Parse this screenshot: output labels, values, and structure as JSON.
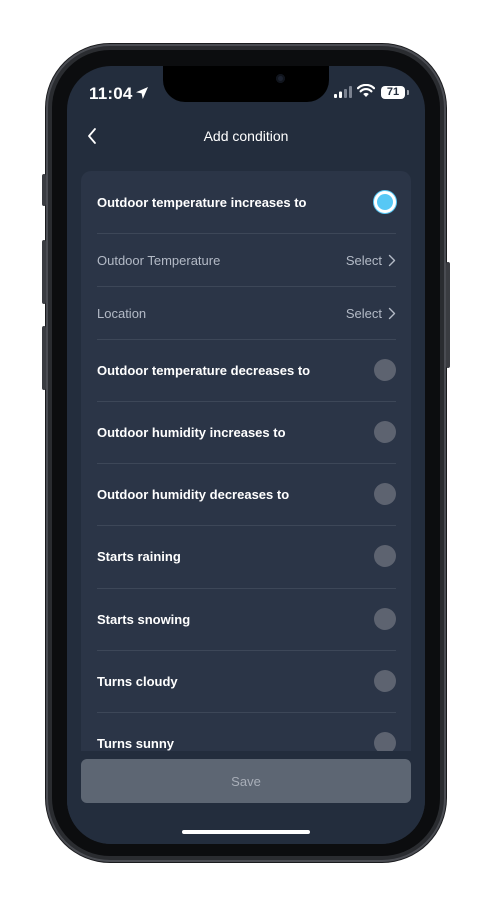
{
  "status_bar": {
    "time": "11:04",
    "battery": "71"
  },
  "header": {
    "title": "Add condition"
  },
  "conditions": [
    {
      "label": "Outdoor temperature increases to",
      "selected": true
    },
    {
      "label": "Outdoor temperature decreases to",
      "selected": false
    },
    {
      "label": "Outdoor humidity increases to",
      "selected": false
    },
    {
      "label": "Outdoor humidity decreases to",
      "selected": false
    },
    {
      "label": "Starts raining",
      "selected": false
    },
    {
      "label": "Starts snowing",
      "selected": false
    },
    {
      "label": "Turns cloudy",
      "selected": false
    },
    {
      "label": "Turns sunny",
      "selected": false
    }
  ],
  "sub_options": [
    {
      "label": "Outdoor Temperature",
      "action": "Select"
    },
    {
      "label": "Location",
      "action": "Select"
    }
  ],
  "footer": {
    "save_label": "Save"
  },
  "colors": {
    "background": "#232d3d",
    "card": "#2b3547",
    "accent": "#57c8f5",
    "radio_off": "#5d6370",
    "save_button": "#5d6673"
  }
}
